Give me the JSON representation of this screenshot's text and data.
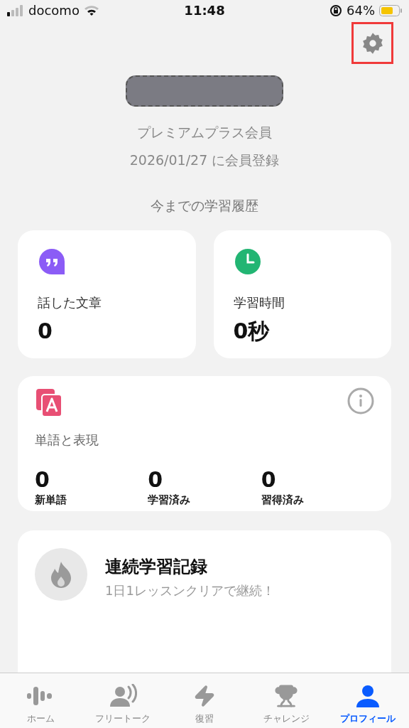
{
  "status_bar": {
    "carrier": "docomo",
    "time": "11:48",
    "battery": "64%"
  },
  "settings": {
    "highlighted": true
  },
  "profile": {
    "membership": "プレミアムプラス会員",
    "registered": "2026/01/27 に会員登録"
  },
  "history_title": "今までの学習履歴",
  "stats": [
    {
      "kind": "sentences",
      "label": "話した文章",
      "value": "0"
    },
    {
      "kind": "time",
      "label": "学習時間",
      "value": "0秒"
    }
  ],
  "vocabulary": {
    "title": "単語と表現",
    "counts": [
      {
        "value": "0",
        "label": "新単語"
      },
      {
        "value": "0",
        "label": "学習済み"
      },
      {
        "value": "0",
        "label": "習得済み"
      }
    ]
  },
  "streak": {
    "title": "連続学習記録",
    "subtitle": "1日1レッスンクリアで継続！"
  },
  "tabs": [
    {
      "kind": "home",
      "label": "ホーム",
      "selected": false
    },
    {
      "kind": "talk",
      "label": "フリートーク",
      "selected": false
    },
    {
      "kind": "review",
      "label": "復習",
      "selected": false
    },
    {
      "kind": "challenge",
      "label": "チャレンジ",
      "selected": false
    },
    {
      "kind": "profile",
      "label": "プロフィール",
      "selected": true
    }
  ]
}
